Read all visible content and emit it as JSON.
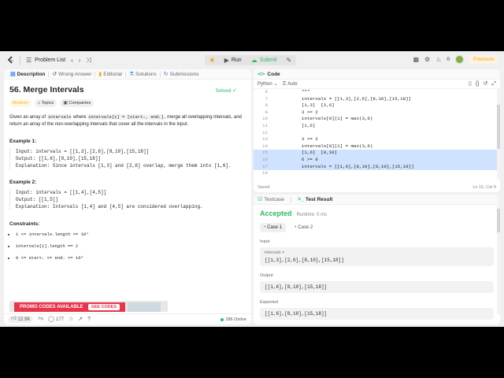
{
  "topbar": {
    "problem_list": "Problem List",
    "run_label": "Run",
    "submit_label": "Submit",
    "count": "0",
    "premium": "Premium"
  },
  "left_tabs": [
    {
      "label": "Description"
    },
    {
      "label": "Wrong Answer"
    },
    {
      "label": "Editorial"
    },
    {
      "label": "Solutions"
    },
    {
      "label": "Submissions"
    }
  ],
  "problem": {
    "title": "56. Merge Intervals",
    "status": "Solved",
    "difficulty": "Medium",
    "tag_topics": "Topics",
    "tag_companies": "Companies",
    "statement_1": "Given an array of ",
    "code_1": "intervals",
    "statement_2": " where ",
    "code_2": "intervals[i] = [startᵢ, endᵢ]",
    "statement_3": ", merge all overlapping intervals, and return an array of the non-overlapping intervals that cover all the intervals in the input.",
    "example1_title": "Example 1:",
    "example1_body": "Input: intervals = [[1,3],[2,6],[8,10],[15,18]]\nOutput: [[1,6],[8,10],[15,18]]\nExplanation: Since intervals [1,3] and [2,6] overlap, merge them into [1,6].",
    "example2_title": "Example 2:",
    "example2_body": "Input: intervals = [[1,4],[4,5]]\nOutput: [[1,5]]\nExplanation: Intervals [1,4] and [4,5] are considered overlapping.",
    "constraints_title": "Constraints:",
    "constraints": [
      "1 <= intervals.length <= 10⁴",
      "intervals[i].length == 2",
      "0 <= startᵢ <= endᵢ <= 10⁴"
    ]
  },
  "ad": {
    "text": "PROMO CODES AVAILABLE",
    "button": "SEE CODES"
  },
  "footer": {
    "likes": "22.9K",
    "comments": "177",
    "online": "286 Online"
  },
  "code": {
    "tab": "Code",
    "language": "Python",
    "mode": "Auto",
    "lines": [
      {
        "n": "6",
        "t": "    \"\"\""
      },
      {
        "n": "7",
        "t": "    intervals = [[1,3],[2,6],[8,10],[15,18]]"
      },
      {
        "n": "8",
        "t": "    [1,3]  [2,6]"
      },
      {
        "n": "9",
        "t": "    3 >= 2"
      },
      {
        "n": "10",
        "t": "    intervals[0][1] = max(3,6)"
      },
      {
        "n": "11",
        "t": "    [1,6]"
      },
      {
        "n": "12",
        "t": ""
      },
      {
        "n": "13",
        "t": "    3 >= 2"
      },
      {
        "n": "14",
        "t": "    intervals[0][1] = max(3,6)"
      },
      {
        "n": "15",
        "t": "    [1,6]  [8,10]"
      },
      {
        "n": "16",
        "t": "    6 >= 8"
      },
      {
        "n": "17",
        "t": "    intervals = [[1,6],[8,10],[8,10],[15,18]]"
      },
      {
        "n": "18",
        "t": ""
      }
    ],
    "saved": "Saved",
    "position": "Ln 15, Col 9"
  },
  "test": {
    "tab_testcase": "Testcase",
    "tab_result": "Test Result",
    "accepted": "Accepted",
    "runtime": "Runtime: 0 ms",
    "case1": "Case 1",
    "case2": "Case 2",
    "input_label": "Input",
    "input_var": "intervals =",
    "input_value": "[[1,3],[2,6],[8,10],[15,18]]",
    "output_label": "Output",
    "output_value": "[[1,6],[8,10],[15,18]]",
    "expected_label": "Expected",
    "expected_value": "[[1,6],[8,10],[15,18]]"
  },
  "colors": {
    "accent_green": "#2cbb5d",
    "accent_orange": "#ffa116",
    "highlight": "#cfe3ff"
  }
}
